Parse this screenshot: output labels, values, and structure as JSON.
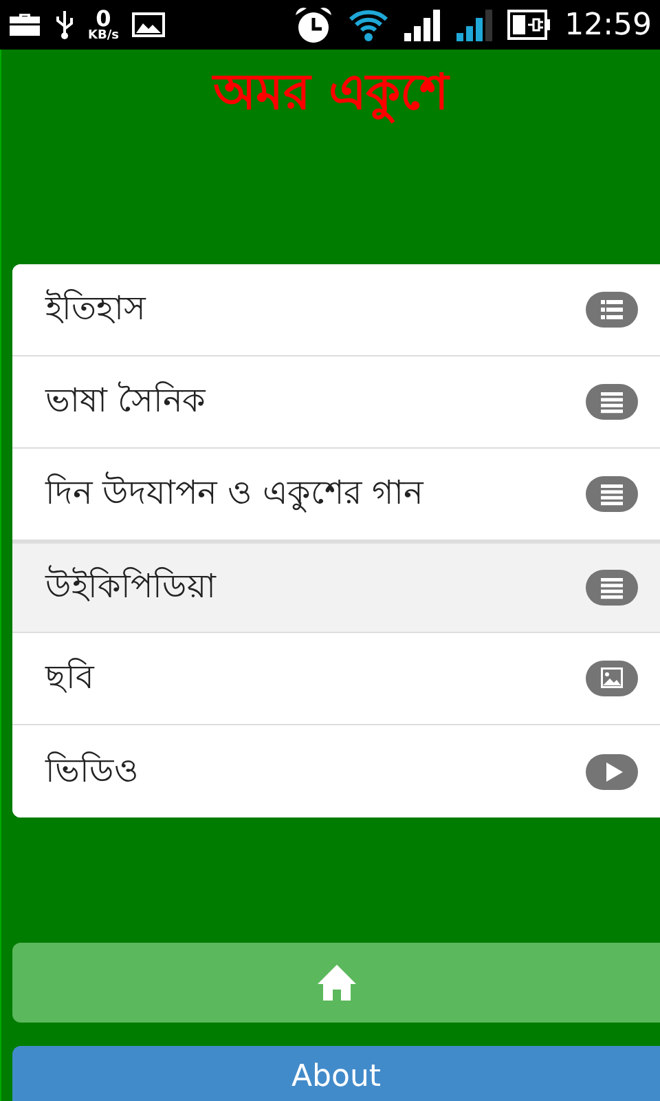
{
  "status_bar": {
    "speed_value": "0",
    "speed_unit": "KB/s",
    "time": "12:59"
  },
  "title": "অমর একুশে",
  "menu": [
    {
      "label": "ইতিহাস",
      "kind": "list",
      "selected": false
    },
    {
      "label": "ভাষা সৈনিক",
      "kind": "lines",
      "selected": false
    },
    {
      "label": "দিন উদযাপন ও একুশের গান",
      "kind": "lines",
      "selected": false
    },
    {
      "label": "উইকিপিডিয়া",
      "kind": "lines",
      "selected": true
    },
    {
      "label": "ছবি",
      "kind": "image",
      "selected": false
    },
    {
      "label": "ভিডিও",
      "kind": "play",
      "selected": false
    }
  ],
  "buttons": [
    {
      "kind": "home"
    },
    {
      "kind": "text",
      "label": "About"
    }
  ]
}
